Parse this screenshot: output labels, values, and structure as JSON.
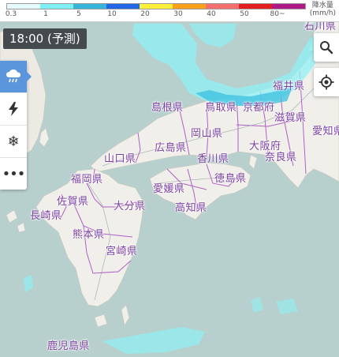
{
  "legend": {
    "unit_title_top": "降水量",
    "unit_title_bottom": "(mm/h)",
    "labels": [
      "0.3",
      "1",
      "5",
      "10",
      "20",
      "30",
      "40",
      "50",
      "80~"
    ],
    "colors": [
      "#e6fbff",
      "#7ef0f5",
      "#35b5d8",
      "#2266e8",
      "#fff03a",
      "#f9a11b",
      "#f56f6f",
      "#e41e1e",
      "#b1188a"
    ]
  },
  "time_badge": "18:00 (予測)",
  "toolbar": {
    "items": [
      {
        "name": "rain",
        "icon": "rain-cloud-icon",
        "active": true
      },
      {
        "name": "lightning",
        "icon": "lightning-icon",
        "active": false
      },
      {
        "name": "snow",
        "icon": "snowflake-icon",
        "active": false
      },
      {
        "name": "more",
        "icon": "more-icon",
        "active": false
      }
    ]
  },
  "right_buttons": [
    {
      "name": "search",
      "icon": "search-icon"
    },
    {
      "name": "location",
      "icon": "location-icon"
    }
  ],
  "places": [
    {
      "key": "ishikawa",
      "label": "石川県"
    },
    {
      "key": "fukui",
      "label": "福井県"
    },
    {
      "key": "shimane",
      "label": "島根県"
    },
    {
      "key": "tottori",
      "label": "鳥取県"
    },
    {
      "key": "kyoto",
      "label": "京都府"
    },
    {
      "key": "shiga",
      "label": "滋賀県"
    },
    {
      "key": "aichi",
      "label": "愛知県"
    },
    {
      "key": "okayama",
      "label": "岡山県"
    },
    {
      "key": "hiroshima",
      "label": "広島県"
    },
    {
      "key": "osaka",
      "label": "大阪府"
    },
    {
      "key": "yamaguchi",
      "label": "山口県"
    },
    {
      "key": "kagawa",
      "label": "香川県"
    },
    {
      "key": "nara",
      "label": "奈良県"
    },
    {
      "key": "tokushima",
      "label": "徳島県"
    },
    {
      "key": "fukuoka",
      "label": "福岡県"
    },
    {
      "key": "ehime",
      "label": "愛媛県"
    },
    {
      "key": "saga",
      "label": "佐賀県"
    },
    {
      "key": "oita",
      "label": "大分県"
    },
    {
      "key": "kochi",
      "label": "高知県"
    },
    {
      "key": "nagasaki",
      "label": "長崎県"
    },
    {
      "key": "kumamoto",
      "label": "熊本県"
    },
    {
      "key": "miyazaki",
      "label": "宮崎県"
    },
    {
      "key": "kagoshima",
      "label": "鹿児島県"
    }
  ],
  "colors": {
    "sea": "#b7d0cd",
    "land": "#f1efea",
    "prefecture_border": "#b05fc8",
    "rain_light": "#8ff0f4",
    "rain_mid": "#3cc0e0"
  }
}
